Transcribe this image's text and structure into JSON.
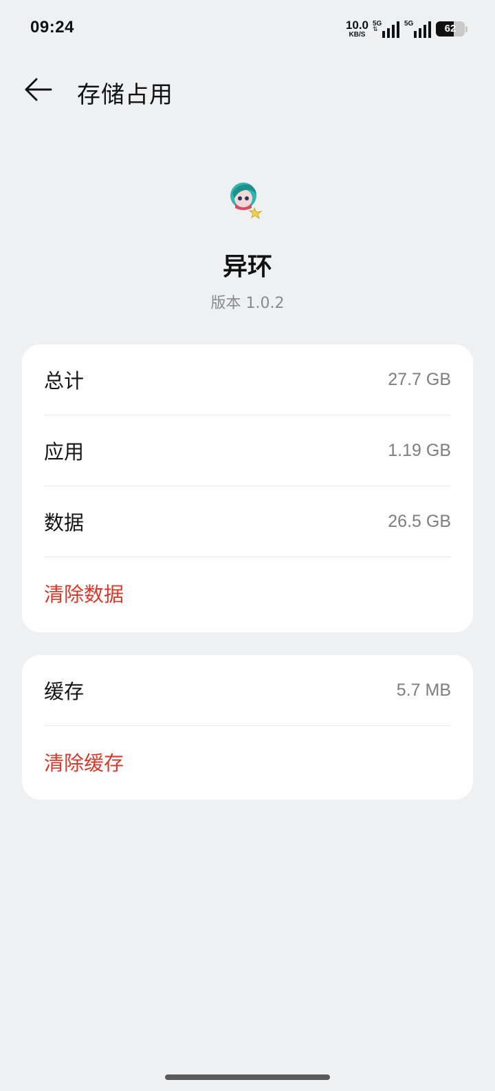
{
  "status_bar": {
    "time": "09:24",
    "net_speed_value": "10.0",
    "net_speed_unit": "KB/S",
    "sim1_label": "5G",
    "sim2_label": "5G",
    "battery_percent": "62",
    "battery_level": 0.62
  },
  "header": {
    "back_icon": "arrow-left-icon",
    "title": "存储占用"
  },
  "app": {
    "icon": "app-avatar-icon",
    "name": "异环",
    "version_label": "版本",
    "version": "1.0.2"
  },
  "storage": {
    "rows": [
      {
        "label": "总计",
        "value": "27.7 GB"
      },
      {
        "label": "应用",
        "value": "1.19 GB"
      },
      {
        "label": "数据",
        "value": "26.5 GB"
      }
    ],
    "clear_data": "清除数据"
  },
  "cache": {
    "label": "缓存",
    "value": "5.7 MB",
    "clear_cache": "清除缓存"
  },
  "colors": {
    "background": "#eff0f2",
    "card": "#ffffff",
    "action_red": "#d33b2d",
    "secondary_text": "#7e7e7e"
  }
}
